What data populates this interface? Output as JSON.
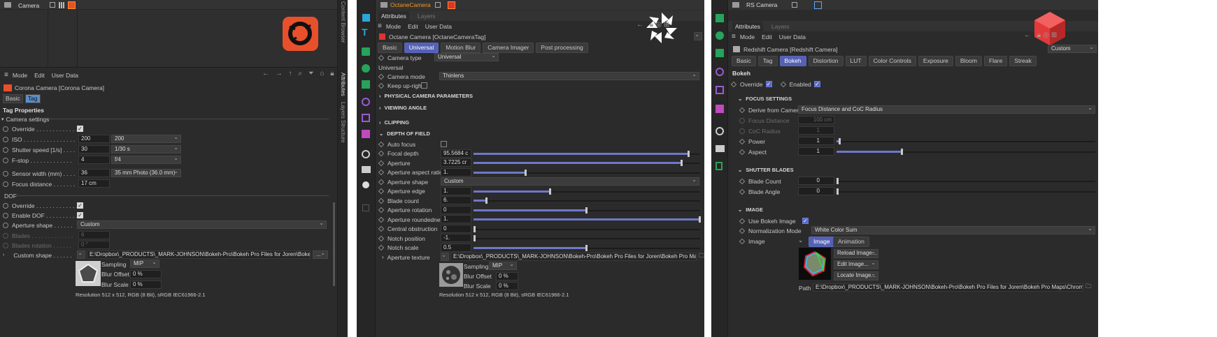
{
  "corona": {
    "object_name": "Camera",
    "menu": [
      "Mode",
      "Edit",
      "User Data"
    ],
    "tag_title": "Corona Camera [Corona Camera]",
    "tabs": [
      "Basic",
      "Tag"
    ],
    "section": "Tag Properties",
    "group_camera": "Camera settings",
    "override_label": "Override . . . . . . . . . . . . .",
    "iso_label": "ISO . . . . . . . . . . . . . . . .",
    "iso_value": "200",
    "iso_preset": "200",
    "shutter_label": "Shutter speed [1/s] . . . .",
    "shutter_value": "30",
    "shutter_preset": "1/30 s",
    "fstop_label": "F-stop . . . . . . . . . . . . .",
    "fstop_value": "4",
    "fstop_preset": "f/4",
    "sensor_label": "Sensor width (mm) . . . .",
    "sensor_value": "36",
    "sensor_preset": "35 mm Photo (36.0 mm)",
    "focus_label": "Focus distance . . . . . . .",
    "focus_value": "17 cm",
    "group_dof": "DOF",
    "dof_override_label": "Override . . . . . . . . . . . . .",
    "enable_dof_label": "Enable DOF . . . . . . . . . .",
    "aperture_shape_label": "Aperture shape . . . . . .",
    "aperture_shape_value": "Custom",
    "blades_label": "Blades . . . . . . . . . . . . .",
    "blades_value": "6",
    "blades_rot_label": "Blades rotation . . . . . .",
    "blades_rot_value": "0 °",
    "custom_shape_label": "Custom shape . . . . . .",
    "custom_shape_path": "E:\\Dropbox\\_PRODUCTS\\_MARK-JOHNSON\\Bokeh-Pro\\Bokeh Pro Files for Joren\\Bokeh Pro Ma",
    "browse": "...",
    "sampling_label": "Sampling",
    "sampling_value": "MIP",
    "blur_offset_label": "Blur Offset",
    "blur_offset_value": "0 %",
    "blur_scale_label": "Blur Scale",
    "blur_scale_value": "0 %",
    "resolution": "Resolution 512 x 512, RGB (8 Bit), sRGB IEC61966-2.1",
    "side_tabs": [
      "Content Browser",
      "Attributes",
      "Layers",
      "Structure"
    ]
  },
  "octane": {
    "object_name": "OctaneCamera",
    "top_tabs": [
      "Attributes",
      "Layers"
    ],
    "menu": [
      "Mode",
      "Edit",
      "User Data"
    ],
    "tag_title": "Octane Camera [OctaneCameraTag]",
    "tabs": [
      "Basic",
      "Universal",
      "Motion Blur",
      "Camera Imager",
      "Post processing"
    ],
    "camera_type_label": "Camera type",
    "camera_type_value": "Universal",
    "section": "Universal",
    "camera_mode_label": "Camera mode",
    "camera_mode_value": "Thinlens",
    "keep_upright_label": "Keep up-right",
    "groups": [
      "PHYSICAL CAMERA PARAMETERS",
      "VIEWING ANGLE",
      "CLIPPING",
      "DEPTH OF FIELD"
    ],
    "params": [
      {
        "label": "Auto focus",
        "type": "check"
      },
      {
        "label": "Focal depth",
        "value": "95.5684 c",
        "slider": 0.95
      },
      {
        "label": "Aperture",
        "value": "3.7225 cr",
        "slider": 0.92
      },
      {
        "label": "Aperture aspect ratio",
        "value": "1.",
        "slider": 0.23
      },
      {
        "label": "Aperture shape",
        "value": "Custom",
        "type": "dropdown"
      },
      {
        "label": "Aperture edge",
        "value": "1.",
        "slider": 0.34
      },
      {
        "label": "Blade count",
        "value": "6.",
        "slider": 0.06
      },
      {
        "label": "Aperture rotation",
        "value": "0",
        "slider": 0.5
      },
      {
        "label": "Aperture roundedness",
        "value": "1.",
        "slider": 1.0
      },
      {
        "label": "Central obstruction",
        "value": "0",
        "slider": 0.0
      },
      {
        "label": "Notch position",
        "value": "-1.",
        "slider": 0.0
      },
      {
        "label": "Notch scale",
        "value": "0.5",
        "slider": 0.5
      }
    ],
    "texture_label": "Aperture texture",
    "texture_path": "E:\\Dropbox\\_PRODUCTS\\_MARK-JOHNSON\\Bokeh-Pro\\Bokeh Pro Files for Joren\\Bokeh Pro Maps\\Pure Texture\\P",
    "sampling_label": "Sampling",
    "sampling_value": "MIP",
    "blur_offset_label": "Blur Offset",
    "blur_offset_value": "0 %",
    "blur_scale_label": "Blur Scale",
    "blur_scale_value": "0 %",
    "resolution": "Resolution 512 x 512, RGB (8 Bit), sRGB IEC61966-2.1"
  },
  "redshift": {
    "object_name": "RS Camera",
    "top_tabs": [
      "Attributes",
      "Layers"
    ],
    "menu": [
      "Mode",
      "Edit",
      "User Data"
    ],
    "tag_title": "Redshift Camera [Redshift Camera]",
    "preset": "Custom",
    "tabs": [
      "Basic",
      "Tag",
      "Bokeh",
      "Distortion",
      "LUT",
      "Color Controls",
      "Exposure",
      "Bloom",
      "Flare",
      "Streak"
    ],
    "section": "Bokeh",
    "override_label": "Override",
    "enabled_label": "Enabled",
    "focus_group": "FOCUS SETTINGS",
    "derive_label": "Derive from Camera",
    "derive_value": "Focus Distance and CoC Radius",
    "focus_distance_label": "Focus Distance",
    "focus_distance_value": "100 cm",
    "coc_label": "CoC Radius",
    "coc_value": "1",
    "power_label": "Power",
    "power_value": "1",
    "power_slider": 0.01,
    "aspect_label": "Aspect",
    "aspect_value": "1",
    "aspect_slider": 0.25,
    "shutter_group": "SHUTTER BLADES",
    "blade_count_label": "Blade Count",
    "blade_count_value": "0",
    "blade_angle_label": "Blade Angle",
    "blade_angle_value": "0",
    "image_group": "IMAGE",
    "use_bokeh_label": "Use Bokeh Image",
    "norm_label": "Normalization Mode",
    "norm_value": "White Color Sum",
    "image_label": "Image",
    "image_tabs": [
      "Image",
      "Animation"
    ],
    "buttons": [
      "Reload Image...",
      "Edit Image...",
      "Locate Image..."
    ],
    "path_label": "Path",
    "path_value": "E:\\Dropbox\\_PRODUCTS\\_MARK-JOHNSON\\Bokeh-Pro\\Bokeh Pro Files for Joren\\Bokeh Pro Maps\\Chromatic + Ti"
  },
  "colors": {
    "panel": "#2b2b2b",
    "accent": "#5461b4",
    "corona": "#e8502b",
    "redshift": "#e23a3a",
    "tags": "#f7941d"
  }
}
